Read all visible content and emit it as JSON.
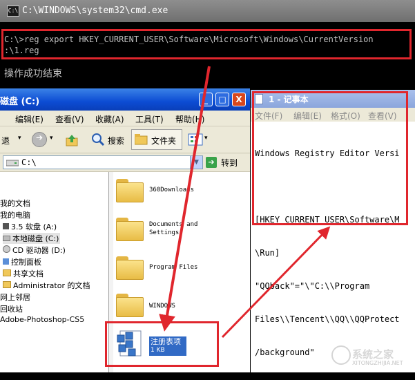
{
  "cmd": {
    "title": "C:\\WINDOWS\\system32\\cmd.exe",
    "icon": "C:\\",
    "line1": "C:\\>reg export HKEY_CURRENT_USER\\Software\\Microsoft\\Windows\\CurrentVersion",
    "line2": ":\\1.reg",
    "line3": "操作成功结束"
  },
  "explorer": {
    "title": "磁盘 (C:)",
    "window_buttons": {
      "min": "_",
      "max": "□",
      "close": "X"
    },
    "menu": [
      "编辑(E)",
      "查看(V)",
      "收藏(A)",
      "工具(T)",
      "帮助(H)"
    ],
    "toolbar": {
      "back": "退",
      "search": "搜索",
      "folders": "文件夹"
    },
    "address": {
      "value": "C:\\",
      "go": "转到"
    },
    "tree": [
      "我的文档",
      "我的电脑",
      "3.5 软盘 (A:)",
      "本地磁盘 (C:)",
      "CD 驱动器 (D:)",
      "控制面板",
      "共享文档",
      "Administrator 的文档",
      "网上邻居",
      "回收站",
      "Adobe-Photoshop-CS5"
    ],
    "files": [
      {
        "name": "360Downloads"
      },
      {
        "name": "Documents and Settings"
      },
      {
        "name": "Program Files"
      },
      {
        "name": "WINDOWS"
      }
    ],
    "reg_file": {
      "name": "注册表项",
      "size": "1 KB"
    }
  },
  "notepad": {
    "title": "1 - 记事本",
    "menu": [
      "文件(F)",
      "编辑(E)",
      "格式(O)",
      "查看(V)"
    ],
    "lines": [
      "Windows Registry Editor Versi",
      "",
      "[HKEY_CURRENT_USER\\Software\\M",
      "\\Run]",
      "\"QQback\"=\"\\\"C:\\\\Program",
      "Files\\\\Tencent\\\\QQ\\\\QQProtect",
      "/background\""
    ]
  },
  "watermark": {
    "text": "系统之家",
    "sub": "XITONGZHIJIA.NET"
  },
  "colors": {
    "highlight": "#e0262d",
    "xp_blue": "#0c4cd4",
    "cmd_bg": "#000000"
  }
}
